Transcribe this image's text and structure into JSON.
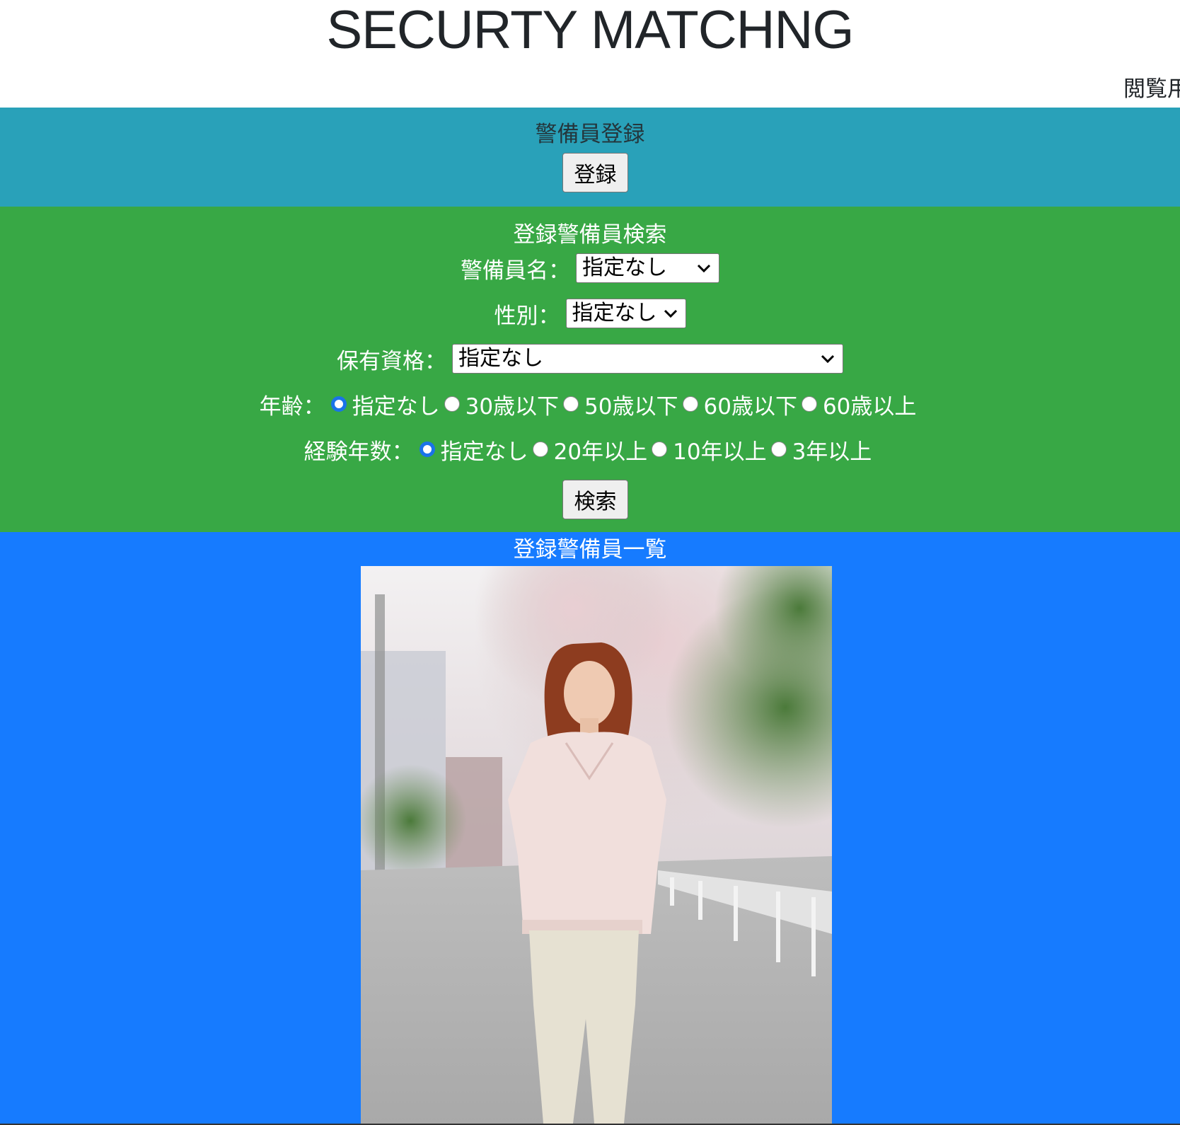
{
  "header": {
    "title": "SECURTY MATCHNG",
    "browse_link": "閲覧用"
  },
  "register_section": {
    "title": "警備員登録",
    "button": "登録",
    "bg_color": "#29a1b9"
  },
  "search_section": {
    "title": "登録警備員検索",
    "bg_color": "#38a845",
    "guard_name": {
      "label": "警備員名：",
      "selected": "指定なし"
    },
    "gender": {
      "label": "性別：",
      "selected": "指定なし"
    },
    "qualification": {
      "label": "保有資格：",
      "selected": "指定なし"
    },
    "age": {
      "label": "年齢：",
      "options": [
        "指定なし",
        "30歳以下",
        "50歳以下",
        "60歳以下",
        "60歳以上"
      ],
      "selected_index": 0
    },
    "experience": {
      "label": "経験年数：",
      "options": [
        "指定なし",
        "20年以上",
        "10年以上",
        "3年以上"
      ],
      "selected_index": 0
    },
    "button": "検索"
  },
  "list_section": {
    "title": "登録警備員一覧",
    "bg_color": "#167bff",
    "photo_icon": "guard-photo"
  },
  "colors": {
    "radio_accent": "#1a73e8"
  }
}
